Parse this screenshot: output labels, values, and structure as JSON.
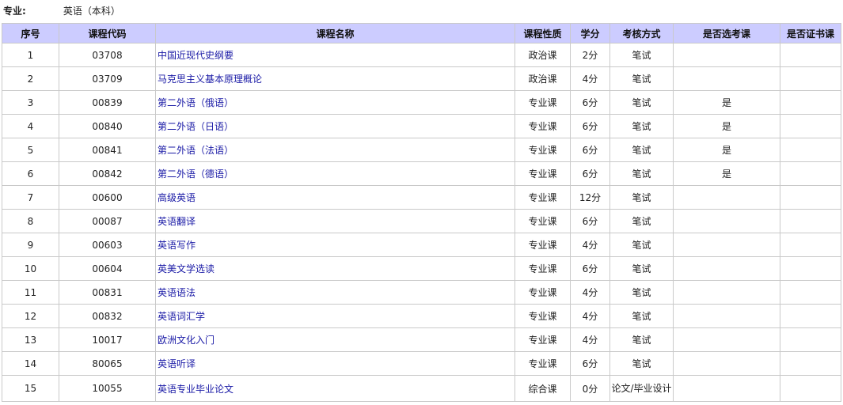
{
  "major": {
    "label": "专业:",
    "value": "英语（本科）"
  },
  "table": {
    "headers": [
      "序号",
      "课程代码",
      "课程名称",
      "课程性质",
      "学分",
      "考核方式",
      "是否选考课",
      "是否证书课"
    ],
    "rows": [
      [
        "1",
        "03708",
        "中国近现代史纲要",
        "政治课",
        "2分",
        "笔试",
        "",
        ""
      ],
      [
        "2",
        "03709",
        "马克思主义基本原理概论",
        "政治课",
        "4分",
        "笔试",
        "",
        ""
      ],
      [
        "3",
        "00839",
        "第二外语（俄语）",
        "专业课",
        "6分",
        "笔试",
        "是",
        ""
      ],
      [
        "4",
        "00840",
        "第二外语（日语）",
        "专业课",
        "6分",
        "笔试",
        "是",
        ""
      ],
      [
        "5",
        "00841",
        "第二外语（法语）",
        "专业课",
        "6分",
        "笔试",
        "是",
        ""
      ],
      [
        "6",
        "00842",
        "第二外语（德语）",
        "专业课",
        "6分",
        "笔试",
        "是",
        ""
      ],
      [
        "7",
        "00600",
        "高级英语",
        "专业课",
        "12分",
        "笔试",
        "",
        ""
      ],
      [
        "8",
        "00087",
        "英语翻译",
        "专业课",
        "6分",
        "笔试",
        "",
        ""
      ],
      [
        "9",
        "00603",
        "英语写作",
        "专业课",
        "4分",
        "笔试",
        "",
        ""
      ],
      [
        "10",
        "00604",
        "英美文学选读",
        "专业课",
        "6分",
        "笔试",
        "",
        ""
      ],
      [
        "11",
        "00831",
        "英语语法",
        "专业课",
        "4分",
        "笔试",
        "",
        ""
      ],
      [
        "12",
        "00832",
        "英语词汇学",
        "专业课",
        "4分",
        "笔试",
        "",
        ""
      ],
      [
        "13",
        "10017",
        "欧洲文化入门",
        "专业课",
        "4分",
        "笔试",
        "",
        ""
      ],
      [
        "14",
        "80065",
        "英语听译",
        "专业课",
        "6分",
        "笔试",
        "",
        ""
      ],
      [
        "15",
        "10055",
        "英语专业毕业论文",
        "综合课",
        "0分",
        "论文/毕业设计",
        "",
        ""
      ]
    ]
  }
}
